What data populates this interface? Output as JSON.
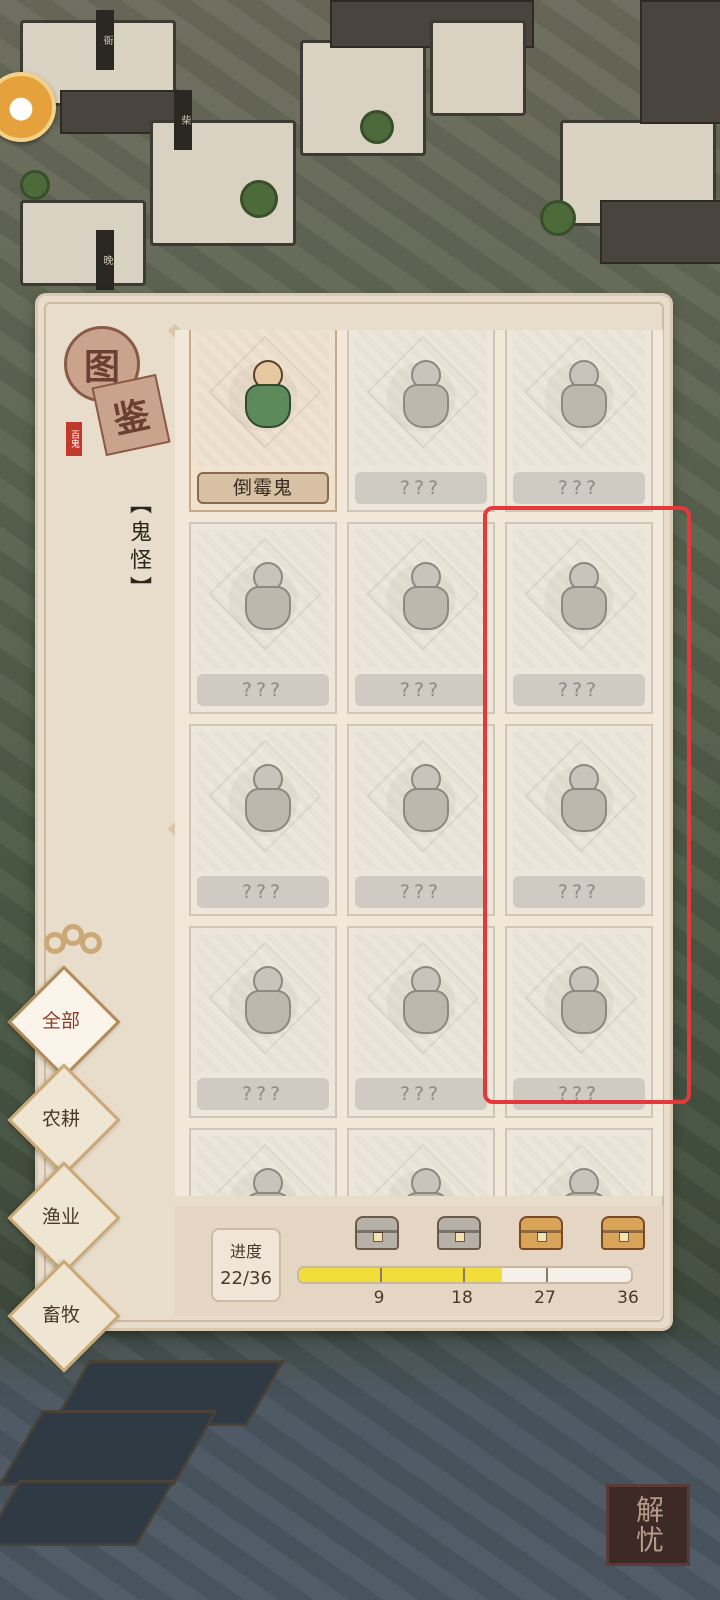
{
  "background": {
    "signs": [
      "衙",
      "柴",
      "晚"
    ],
    "corner_button_label": "解忧"
  },
  "book": {
    "title_char_1": "图",
    "title_char_2": "鉴",
    "seal_text": "百鬼",
    "category": "【鬼怪】"
  },
  "tabs": [
    {
      "label": "全部",
      "active": true
    },
    {
      "label": "农耕",
      "active": false
    },
    {
      "label": "渔业",
      "active": false
    },
    {
      "label": "畜牧",
      "active": false
    }
  ],
  "cards": [
    {
      "name": "倒霉鬼",
      "unlocked": true
    },
    {
      "name": "???",
      "unlocked": false
    },
    {
      "name": "???",
      "unlocked": false
    },
    {
      "name": "???",
      "unlocked": false
    },
    {
      "name": "???",
      "unlocked": false
    },
    {
      "name": "???",
      "unlocked": false
    },
    {
      "name": "???",
      "unlocked": false
    },
    {
      "name": "???",
      "unlocked": false
    },
    {
      "name": "???",
      "unlocked": false
    },
    {
      "name": "???",
      "unlocked": false
    },
    {
      "name": "???",
      "unlocked": false
    },
    {
      "name": "???",
      "unlocked": false
    },
    {
      "name": "",
      "unlocked": false
    },
    {
      "name": "",
      "unlocked": false
    },
    {
      "name": "",
      "unlocked": false
    }
  ],
  "progress": {
    "label": "进度",
    "value_text": "22/36",
    "current": 22,
    "total": 36,
    "milestones": [
      {
        "value": "9",
        "chest": "gray"
      },
      {
        "value": "18",
        "chest": "gray"
      },
      {
        "value": "27",
        "chest": "gold"
      },
      {
        "value": "36",
        "chest": "gold"
      }
    ]
  },
  "colors": {
    "highlight_box": "#e5383b",
    "progress_fill": "#f1de3a"
  }
}
